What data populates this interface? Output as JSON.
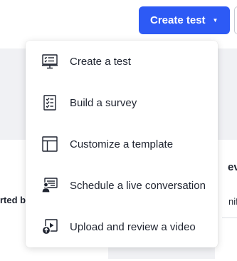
{
  "header": {
    "create_button_label": "Create test",
    "create_button_color": "#2d5af5"
  },
  "background": {
    "left_text": "rted b",
    "right_heading": "ev",
    "right_text": "nif"
  },
  "menu": {
    "items": [
      {
        "label": "Create a test",
        "icon": "presentation-checklist-icon"
      },
      {
        "label": "Build a survey",
        "icon": "checklist-icon"
      },
      {
        "label": "Customize a template",
        "icon": "template-layout-icon"
      },
      {
        "label": "Schedule a live conversation",
        "icon": "live-conversation-icon"
      },
      {
        "label": "Upload and review a video",
        "icon": "video-upload-icon"
      }
    ]
  }
}
